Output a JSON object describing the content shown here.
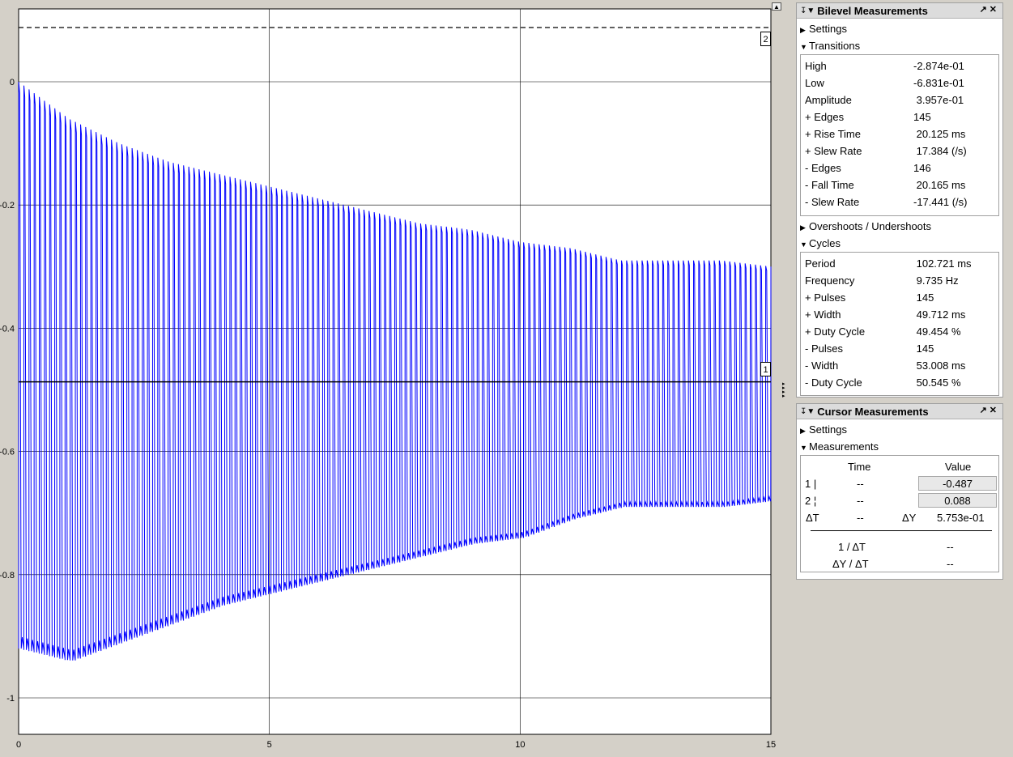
{
  "scope": {
    "y_ticks": [
      "0",
      "-0.2",
      "-0.4",
      "-0.6",
      "-0.8",
      "-1"
    ],
    "x_ticks": [
      "0",
      "5",
      "10",
      "15"
    ],
    "cursor1_tag": "1",
    "cursor2_tag": "2",
    "colors": {
      "signal": "#0000ff",
      "background": "#ffffff",
      "grid": "#000000"
    }
  },
  "chart_data": {
    "type": "line",
    "title": "",
    "xlabel": "",
    "ylabel": "",
    "xlim": [
      0,
      15
    ],
    "ylim": [
      -1.08,
      0.12
    ],
    "y_ticks": [
      0,
      -0.2,
      -0.4,
      -0.6,
      -0.8,
      -1
    ],
    "x_ticks": [
      0,
      5,
      10,
      15
    ],
    "grid": true,
    "series": [
      {
        "description": "square-ish oscillation ~9.7 Hz, decaying envelope",
        "frequency_hz": 9.735,
        "upper_envelope": {
          "t": [
            0,
            1,
            2,
            3,
            4,
            5,
            6,
            7,
            8,
            9,
            10,
            11,
            12,
            13,
            14,
            15
          ],
          "y": [
            0.0,
            -0.06,
            -0.1,
            -0.13,
            -0.15,
            -0.17,
            -0.19,
            -0.21,
            -0.23,
            -0.24,
            -0.26,
            -0.27,
            -0.29,
            -0.29,
            -0.29,
            -0.3
          ]
        },
        "lower_envelope": {
          "t": [
            0,
            1,
            2,
            3,
            4,
            5,
            6,
            7,
            8,
            9,
            10,
            11,
            12,
            13,
            14,
            15
          ],
          "y": [
            -0.92,
            -0.94,
            -0.91,
            -0.88,
            -0.85,
            -0.83,
            -0.81,
            -0.79,
            -0.77,
            -0.75,
            -0.74,
            -0.71,
            -0.69,
            -0.69,
            -0.69,
            -0.68
          ]
        }
      }
    ],
    "cursors": [
      {
        "name": "1",
        "y": -0.487,
        "style": "solid"
      },
      {
        "name": "2",
        "y": 0.088,
        "style": "dashed"
      }
    ]
  },
  "bilevel": {
    "title": "Bilevel Measurements",
    "settings_label": "Settings",
    "transitions_label": "Transitions",
    "transitions": [
      {
        "label": "High",
        "value": "-2.874e-01"
      },
      {
        "label": "Low",
        "value": "-6.831e-01"
      },
      {
        "label": "Amplitude",
        "value": " 3.957e-01"
      },
      {
        "label": "+ Edges",
        "value": "145"
      },
      {
        "label": "+ Rise Time",
        "value": " 20.125 ms"
      },
      {
        "label": "+ Slew Rate",
        "value": " 17.384 (/s)"
      },
      {
        "label": "- Edges",
        "value": "146"
      },
      {
        "label": "- Fall Time",
        "value": " 20.165 ms"
      },
      {
        "label": "- Slew Rate",
        "value": "-17.441 (/s)"
      }
    ],
    "overshoots_label": "Overshoots / Undershoots",
    "cycles_label": "Cycles",
    "cycles": [
      {
        "label": "Period",
        "value": " 102.721 ms"
      },
      {
        "label": "Frequency",
        "value": " 9.735 Hz"
      },
      {
        "label": "+ Pulses",
        "value": " 145"
      },
      {
        "label": "+ Width",
        "value": " 49.712 ms"
      },
      {
        "label": "+ Duty Cycle",
        "value": " 49.454 %"
      },
      {
        "label": "- Pulses",
        "value": " 145"
      },
      {
        "label": "- Width",
        "value": " 53.008 ms"
      },
      {
        "label": "- Duty Cycle",
        "value": " 50.545 %"
      }
    ]
  },
  "cursor": {
    "title": "Cursor Measurements",
    "settings_label": "Settings",
    "measurements_label": "Measurements",
    "col_time": "Time",
    "col_value": "Value",
    "c1_label": "1 |",
    "c1_time": "--",
    "c1_value": "-0.487",
    "c2_label": "2 ¦",
    "c2_time": "--",
    "c2_value": "0.088",
    "dt_label": "ΔT",
    "dt_value": "--",
    "dy_label": "ΔY",
    "dy_value": "5.753e-01",
    "inv_dt_label": "1 / ΔT",
    "inv_dt_value": "--",
    "dydt_label": "ΔY / ΔT",
    "dydt_value": "--"
  }
}
